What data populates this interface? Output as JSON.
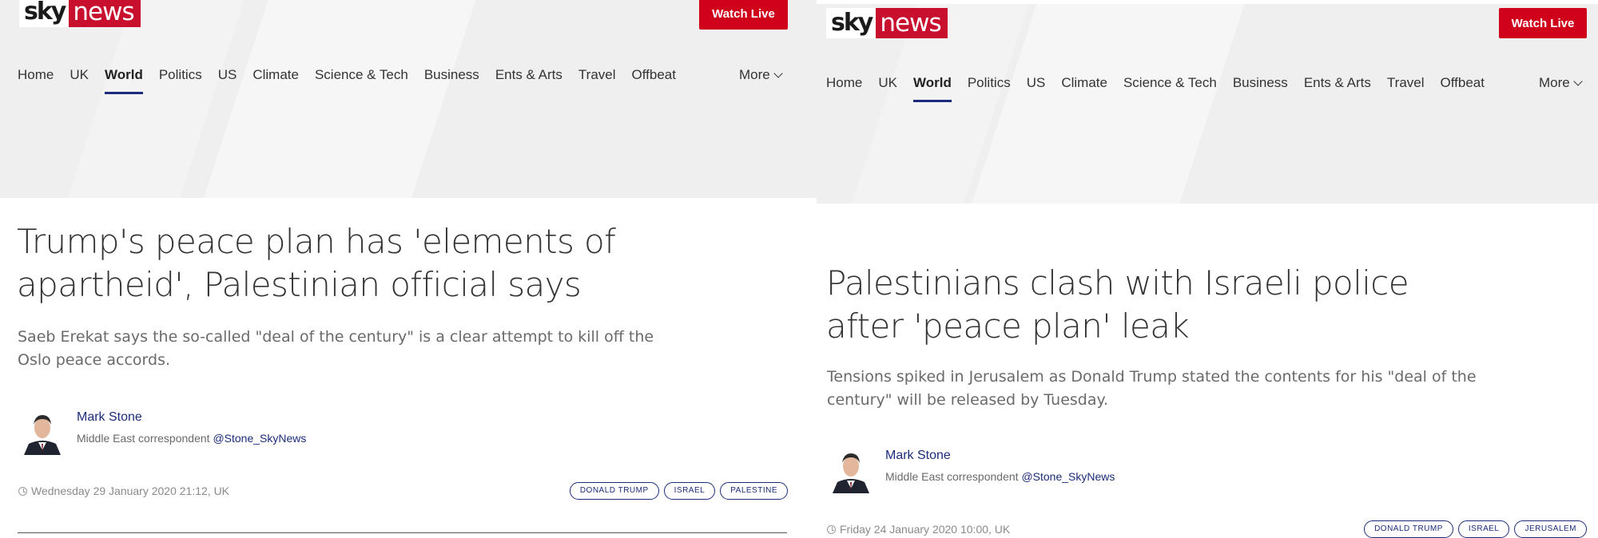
{
  "brand": {
    "sky": "sky",
    "news": "news",
    "color": "#c8102e"
  },
  "header": {
    "watch_live": "Watch Live"
  },
  "nav": {
    "items": [
      "Home",
      "UK",
      "World",
      "Politics",
      "US",
      "Climate",
      "Science & Tech",
      "Business",
      "Ents & Arts",
      "Travel",
      "Offbeat"
    ],
    "active": "World",
    "more": "More"
  },
  "articles": [
    {
      "headline_line1": "Trump's peace plan has 'elements of",
      "headline_line2": "apartheid', Palestinian official says",
      "standfirst_line1": "Saeb Erekat says the so-called \"deal of the century\" is a clear attempt to kill off the",
      "standfirst_line2": "Oslo peace accords.",
      "author": {
        "name": "Mark Stone",
        "role": "Middle East correspondent",
        "handle": "@Stone_SkyNews"
      },
      "date": "Wednesday 29 January 2020 21:12, UK",
      "tags": [
        "DONALD TRUMP",
        "ISRAEL",
        "PALESTINE"
      ]
    },
    {
      "headline_line1": "Palestinians clash with Israeli police",
      "headline_line2": "after 'peace plan' leak",
      "standfirst_line1": "Tensions spiked in Jerusalem as Donald Trump stated the contents for his \"deal of the",
      "standfirst_line2": "century\" will be released by Tuesday.",
      "author": {
        "name": "Mark Stone",
        "role": "Middle East correspondent",
        "handle": "@Stone_SkyNews"
      },
      "date": "Friday 24 January 2020 10:00, UK",
      "tags": [
        "DONALD TRUMP",
        "ISRAEL",
        "JERUSALEM"
      ]
    }
  ],
  "icons": {
    "clock": "clock-icon",
    "chevron": "chevron-down-icon",
    "avatar": "author-avatar"
  }
}
